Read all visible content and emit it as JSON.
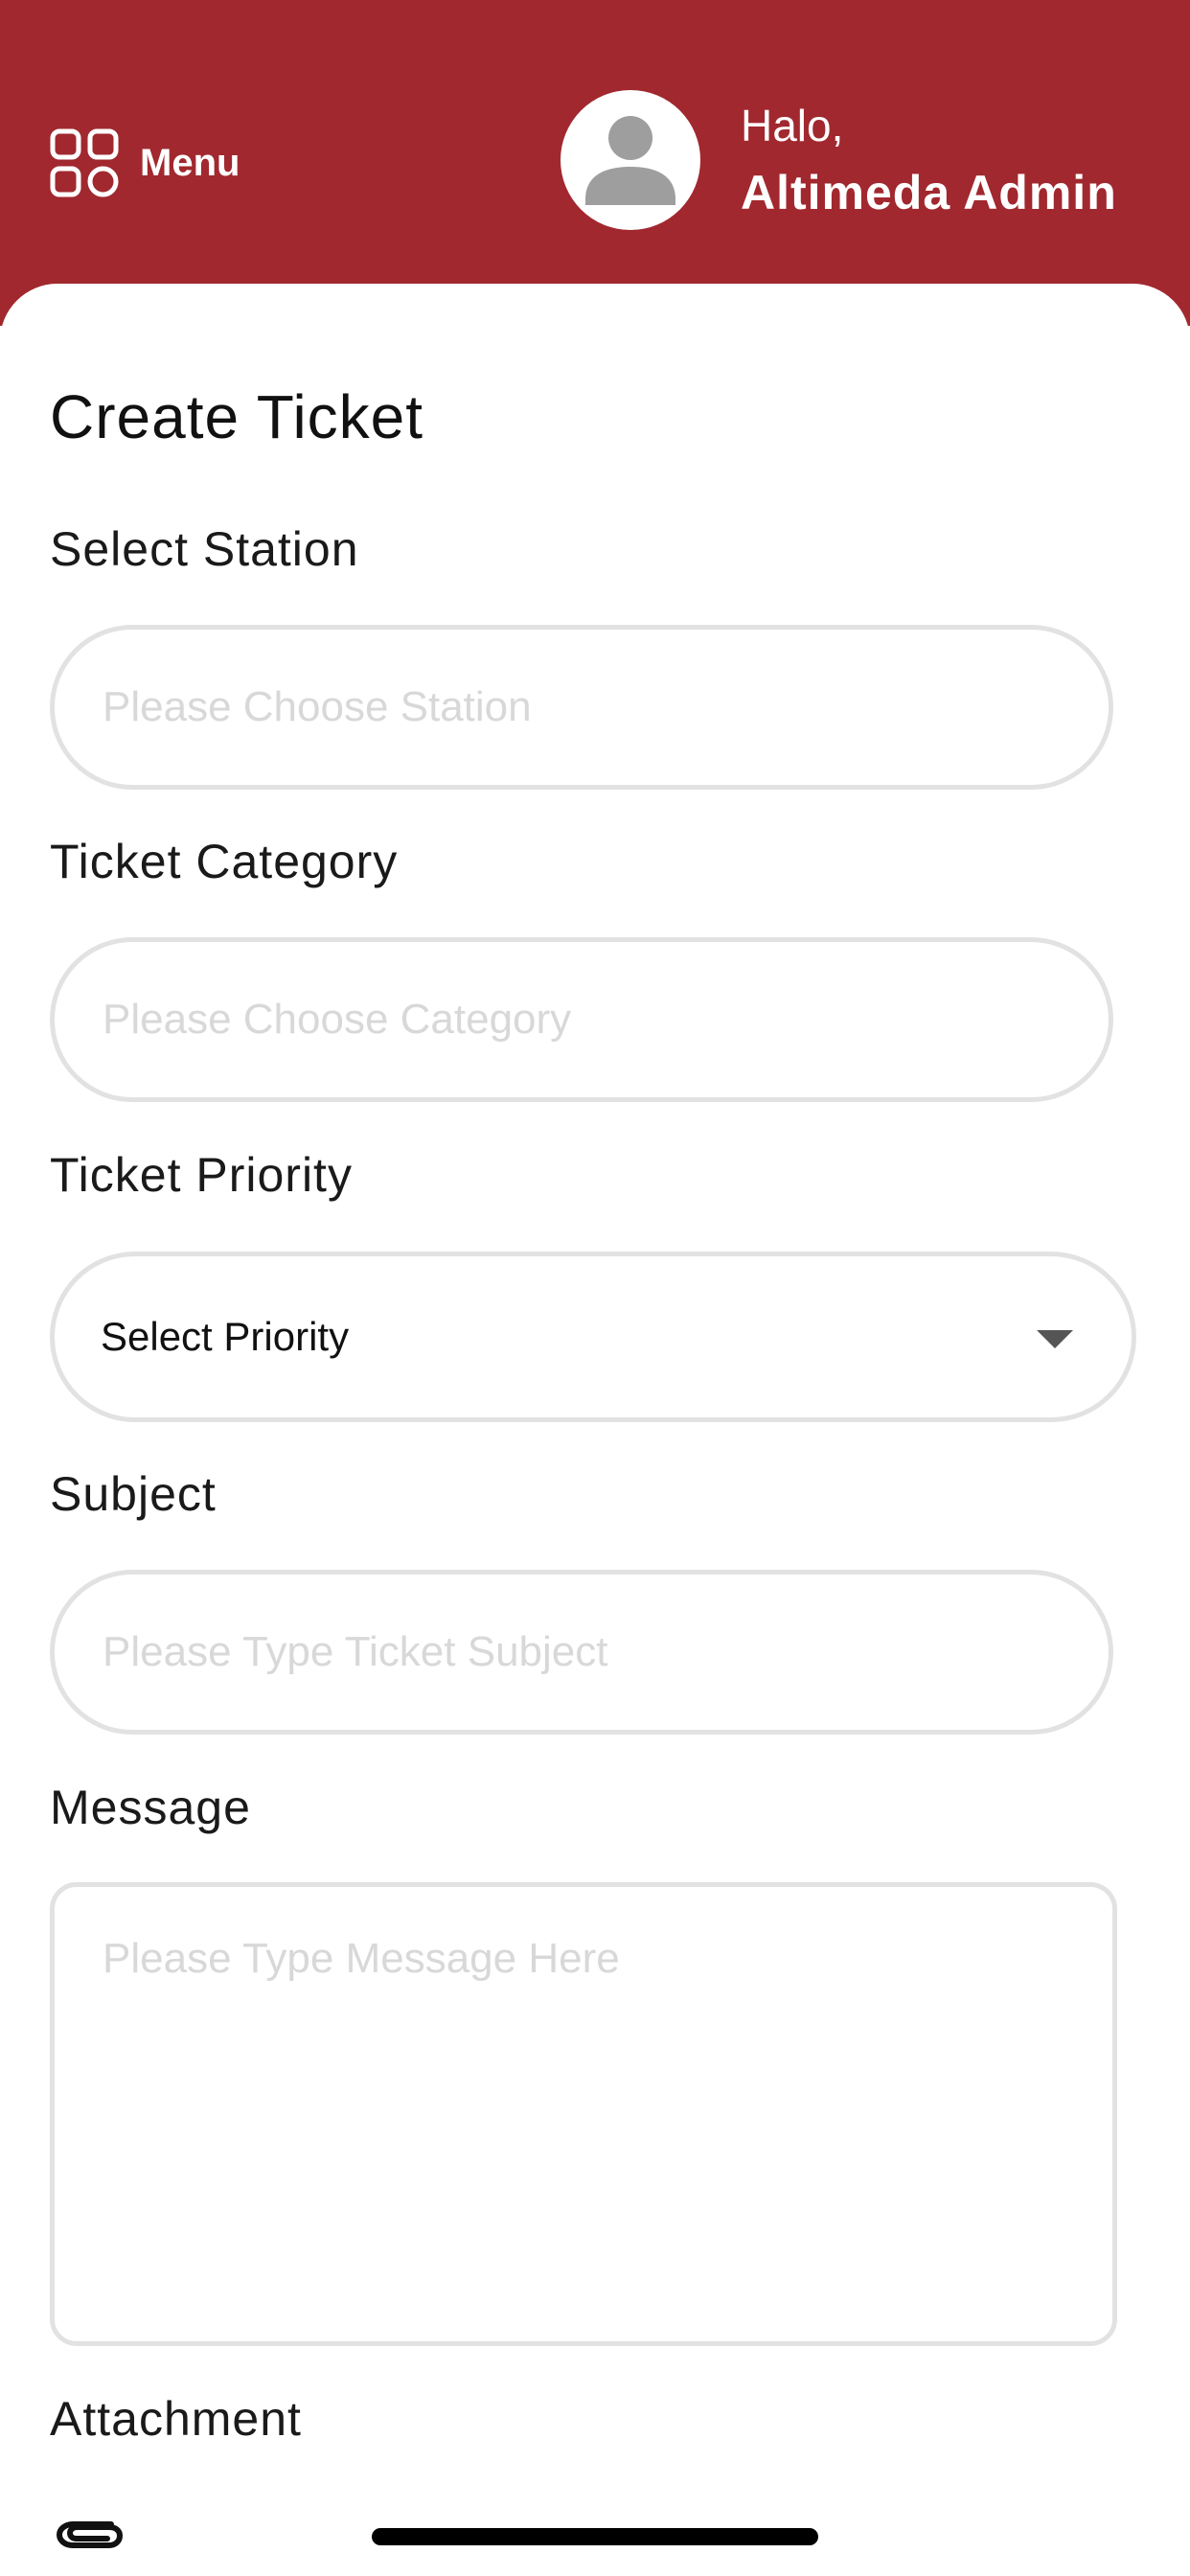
{
  "header": {
    "menu_label": "Menu",
    "menu_icon": "grid-icon",
    "greeting": "Halo,",
    "user_name": "Altimeda Admin",
    "avatar_icon": "user-avatar-icon",
    "background_color": "#a1282f"
  },
  "page": {
    "title": "Create Ticket"
  },
  "form": {
    "station": {
      "label": "Select Station",
      "placeholder": "Please Choose Station",
      "value": ""
    },
    "category": {
      "label": "Ticket Category",
      "placeholder": "Please Choose Category",
      "value": ""
    },
    "priority": {
      "label": "Ticket Priority",
      "selected": "Select Priority"
    },
    "subject": {
      "label": "Subject",
      "placeholder": "Please Type Ticket Subject",
      "value": ""
    },
    "message": {
      "label": "Message",
      "placeholder": "Please Type Message Here",
      "value": ""
    },
    "attachment": {
      "label": "Attachment",
      "icon": "paperclip-icon"
    }
  }
}
